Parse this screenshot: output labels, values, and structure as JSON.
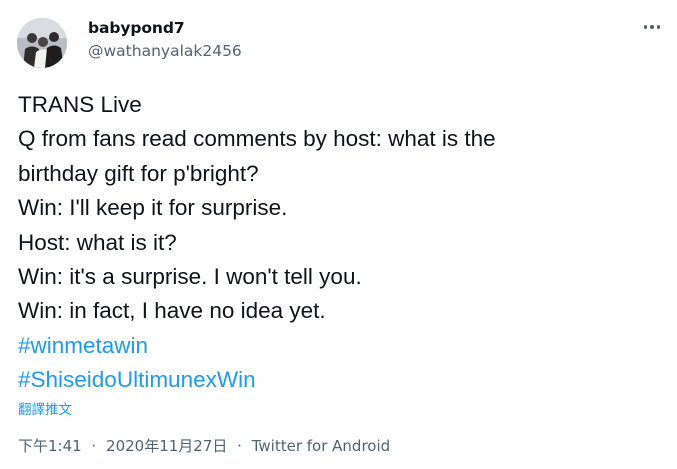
{
  "author": {
    "display_name": "babypond7",
    "handle": "@wathanyalak2456"
  },
  "tweet": {
    "lines": [
      "TRANS Live",
      "Q from fans read comments by host: what is the",
      "birthday gift for p'bright?",
      "Win: I'll keep it for surprise.",
      "Host: what is it?",
      "Win: it's a surprise. I won't tell you.",
      "Win: in fact, I have no idea yet."
    ],
    "hashtags": [
      "#winmetawin",
      "#ShiseidoUltimunexWin"
    ],
    "translate_label": "翻譯推文"
  },
  "meta": {
    "time": "下午1:41",
    "separator": "·",
    "date": "2020年11月27日",
    "source": "Twitter for Android"
  },
  "icons": {
    "more": "more-horizontal-icon",
    "avatar": "profile-photo"
  },
  "colors": {
    "link": "#1d9bf0",
    "secondary_text": "#536471",
    "primary_text": "#0f1419"
  }
}
